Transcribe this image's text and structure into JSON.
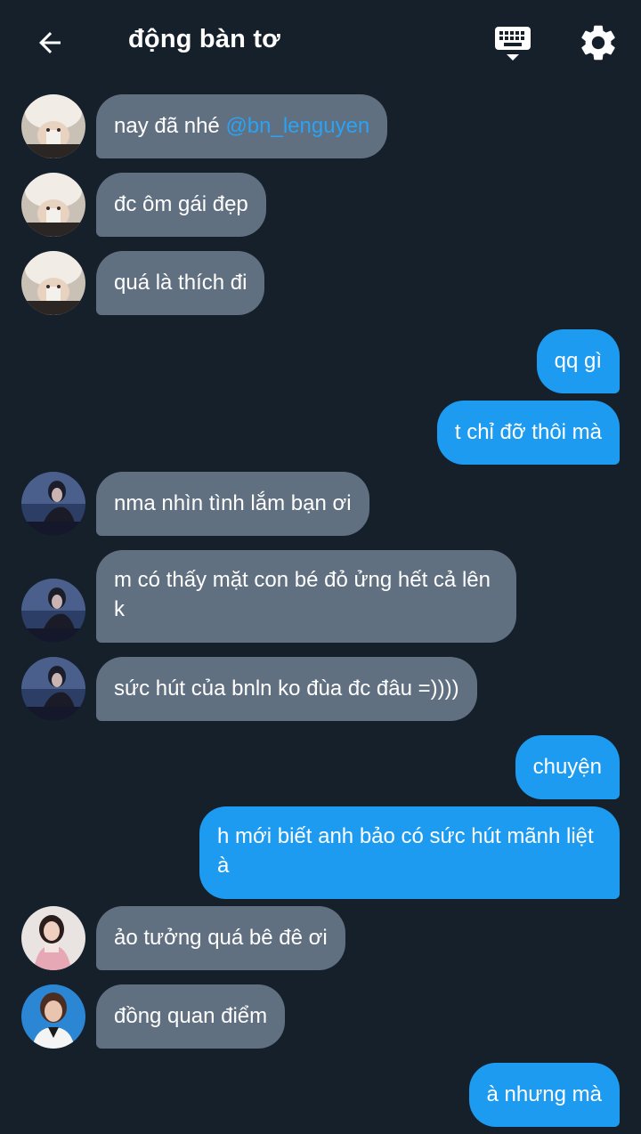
{
  "header": {
    "title": "động bàn tơ",
    "back_icon": "back-arrow-icon",
    "keyboard_icon": "keyboard-icon",
    "settings_icon": "gear-icon"
  },
  "colors": {
    "background": "#16202b",
    "incoming_bubble": "#607080",
    "outgoing_bubble": "#1d9bf0",
    "mention": "#2aa2f5"
  },
  "messages": [
    {
      "dir": "in",
      "text": "nay đã nhé ",
      "mention": "@bn_lenguyen",
      "avatar": "avatar-white-hat"
    },
    {
      "dir": "in",
      "text": "đc ôm gái đẹp",
      "avatar": "avatar-white-hat"
    },
    {
      "dir": "in",
      "text": "quá là thích đi",
      "avatar": "avatar-white-hat"
    },
    {
      "dir": "out",
      "text": "qq gì"
    },
    {
      "dir": "out",
      "text": "t chỉ đỡ thôi mà"
    },
    {
      "dir": "in",
      "text": "nma nhìn tình lắm bạn ơi",
      "avatar": "avatar-dark-girl"
    },
    {
      "dir": "in",
      "text": "m có thấy mặt con bé đỏ ửng hết cả lên k",
      "avatar": "avatar-dark-girl"
    },
    {
      "dir": "in",
      "text": "sức hút của bnln ko đùa đc đâu =))))",
      "avatar": "avatar-dark-girl"
    },
    {
      "dir": "out",
      "text": "chuyện"
    },
    {
      "dir": "out",
      "text": "h mới biết anh bảo có sức hút mãnh liệt à"
    },
    {
      "dir": "in",
      "text": "ảo tưởng quá bê đê ơi",
      "avatar": "avatar-pink-girl"
    },
    {
      "dir": "in",
      "text": "đồng quan điểm",
      "avatar": "avatar-blue-girl"
    },
    {
      "dir": "out",
      "text": "à nhưng mà"
    }
  ]
}
